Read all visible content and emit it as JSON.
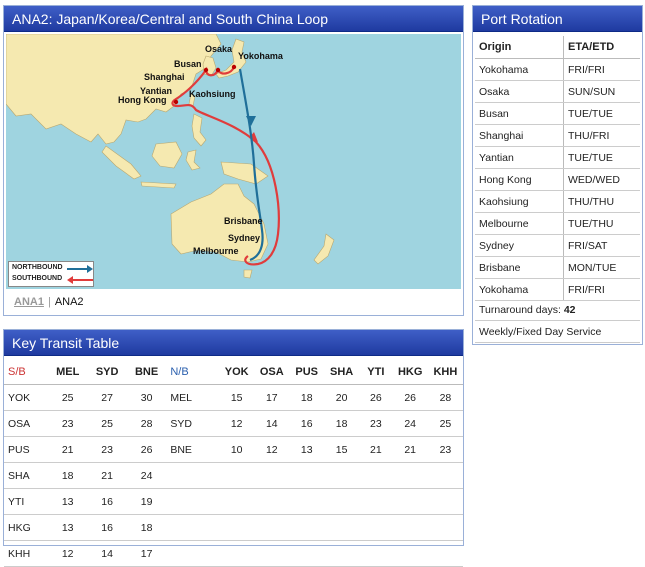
{
  "map_panel": {
    "title": "ANA2: Japan/Korea/Central and South China Loop",
    "labels": {
      "osaka": "Osaka",
      "yokohama": "Yokohama",
      "busan": "Busan",
      "shanghai": "Shanghai",
      "yantian": "Yantian",
      "hong_kong": "Hong Kong",
      "kaohsiung": "Kaohsiung",
      "brisbane": "Brisbane",
      "sydney": "Sydney",
      "melbourne": "Melbourne"
    },
    "legend": {
      "northbound": "NORTHBOUND",
      "southbound": "SOUTHBOUND"
    },
    "tabs": {
      "tab1": "ANA1",
      "separator": "|",
      "tab2": "ANA2"
    },
    "colors": {
      "northbound": "#1f6f99",
      "southbound": "#e03c3c",
      "sea": "#9fd4e0",
      "land": "#f5e9b0"
    }
  },
  "port_rotation": {
    "title": "Port Rotation",
    "headers": [
      "Origin",
      "ETA/ETD"
    ],
    "rows": [
      [
        "Yokohama",
        "FRI/FRI"
      ],
      [
        "Osaka",
        "SUN/SUN"
      ],
      [
        "Busan",
        "TUE/TUE"
      ],
      [
        "Shanghai",
        "THU/FRI"
      ],
      [
        "Yantian",
        "TUE/TUE"
      ],
      [
        "Hong Kong",
        "WED/WED"
      ],
      [
        "Kaohsiung",
        "THU/THU"
      ],
      [
        "Melbourne",
        "TUE/THU"
      ],
      [
        "Sydney",
        "FRI/SAT"
      ],
      [
        "Brisbane",
        "MON/TUE"
      ],
      [
        "Yokohama",
        "FRI/FRI"
      ]
    ],
    "turnaround_label": "Turnaround days:",
    "turnaround_value": "42",
    "service_note": "Weekly/Fixed Day Service"
  },
  "key_transit": {
    "title": "Key Transit Table",
    "sb_headers": [
      "S/B",
      "MEL",
      "SYD",
      "BNE"
    ],
    "nb_headers": [
      "N/B",
      "YOK",
      "OSA",
      "PUS",
      "SHA",
      "YTI",
      "HKG",
      "KHH"
    ],
    "sb_rows": [
      [
        "YOK",
        "25",
        "27",
        "30"
      ],
      [
        "OSA",
        "23",
        "25",
        "28"
      ],
      [
        "PUS",
        "21",
        "23",
        "26"
      ],
      [
        "SHA",
        "18",
        "21",
        "24"
      ],
      [
        "YTI",
        "13",
        "16",
        "19"
      ],
      [
        "HKG",
        "13",
        "16",
        "18"
      ],
      [
        "KHH",
        "12",
        "14",
        "17"
      ]
    ],
    "nb_rows": [
      [
        "MEL",
        "15",
        "17",
        "18",
        "20",
        "26",
        "26",
        "28"
      ],
      [
        "SYD",
        "12",
        "14",
        "16",
        "18",
        "23",
        "24",
        "25"
      ],
      [
        "BNE",
        "10",
        "12",
        "13",
        "15",
        "21",
        "21",
        "23"
      ]
    ]
  }
}
